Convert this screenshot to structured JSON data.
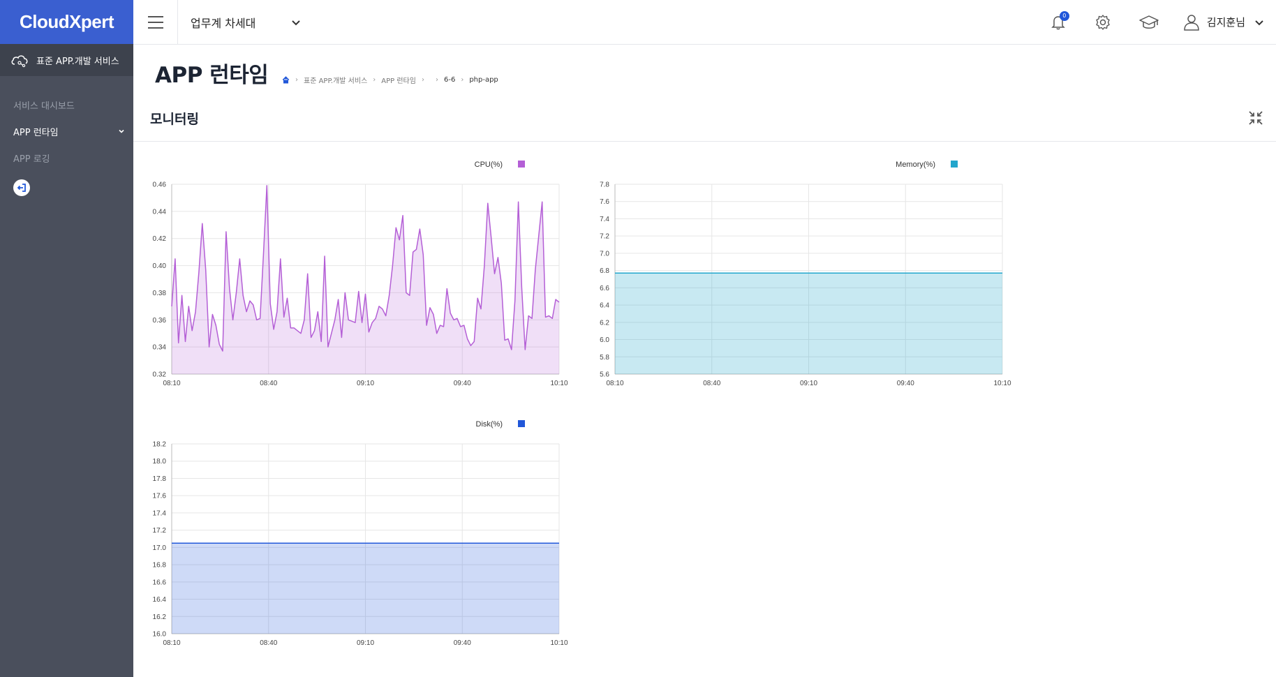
{
  "app": {
    "logo": "CloudXpert"
  },
  "sidebar": {
    "service_label": "표준 APP.개발 서비스",
    "items": [
      {
        "label": "서비스 대시보드",
        "active": false
      },
      {
        "label": "APP 런타임",
        "active": true
      },
      {
        "label": "APP 로깅",
        "active": false
      }
    ]
  },
  "header": {
    "workspace": "업무계 차세대",
    "notification_count": "0",
    "user_name": "김지훈님"
  },
  "page": {
    "title": "APP 런타임",
    "breadcrumb": [
      "표준 APP.개발 서비스",
      "APP 런타임",
      "",
      "6-6",
      "php-app"
    ]
  },
  "section": {
    "title": "모니터링"
  },
  "colors": {
    "accent": "#3a5fd0",
    "cpu": "#b45fd6",
    "memory": "#22a6cc",
    "disk": "#2157d9"
  },
  "chart_data": [
    {
      "type": "area",
      "title": "",
      "legend": "CPU(%)",
      "x_ticks": [
        "08:10",
        "08:40",
        "09:10",
        "09:40",
        "10:10"
      ],
      "ylim": [
        0.32,
        0.46
      ],
      "y_ticks": [
        "0.46",
        "0.44",
        "0.42",
        "0.40",
        "0.38",
        "0.36",
        "0.34",
        "0.32"
      ],
      "grid": true,
      "series": [
        {
          "name": "CPU(%)",
          "values": [
            0.37,
            0.405,
            0.343,
            0.378,
            0.344,
            0.37,
            0.352,
            0.366,
            0.395,
            0.431,
            0.397,
            0.34,
            0.364,
            0.356,
            0.342,
            0.337,
            0.425,
            0.383,
            0.36,
            0.38,
            0.405,
            0.378,
            0.366,
            0.374,
            0.371,
            0.36,
            0.361,
            0.408,
            0.459,
            0.372,
            0.353,
            0.366,
            0.405,
            0.362,
            0.376,
            0.354,
            0.354,
            0.352,
            0.35,
            0.36,
            0.394,
            0.347,
            0.352,
            0.366,
            0.344,
            0.407,
            0.34,
            0.35,
            0.36,
            0.375,
            0.347,
            0.38,
            0.36,
            0.359,
            0.358,
            0.381,
            0.358,
            0.379,
            0.351,
            0.358,
            0.361,
            0.37,
            0.368,
            0.363,
            0.378,
            0.4,
            0.428,
            0.419,
            0.437,
            0.38,
            0.378,
            0.41,
            0.412,
            0.427,
            0.408,
            0.356,
            0.369,
            0.364,
            0.35,
            0.356,
            0.355,
            0.383,
            0.365,
            0.36,
            0.361,
            0.355,
            0.356,
            0.346,
            0.341,
            0.344,
            0.376,
            0.368,
            0.4,
            0.446,
            0.421,
            0.394,
            0.406,
            0.387,
            0.345,
            0.346,
            0.338,
            0.374,
            0.447,
            0.384,
            0.338,
            0.363,
            0.361,
            0.397,
            0.422,
            0.447,
            0.362,
            0.363,
            0.361,
            0.375,
            0.373
          ]
        }
      ]
    },
    {
      "type": "area",
      "title": "",
      "legend": "Memory(%)",
      "x_ticks": [
        "08:10",
        "08:40",
        "09:10",
        "09:40",
        "10:10"
      ],
      "ylim": [
        5.6,
        7.8
      ],
      "y_ticks": [
        "7.8",
        "7.6",
        "7.4",
        "7.2",
        "7.0",
        "6.8",
        "6.6",
        "6.4",
        "6.2",
        "6.0",
        "5.8",
        "5.6"
      ],
      "grid": true,
      "series": [
        {
          "name": "Memory(%)",
          "values": [
            6.77,
            6.77
          ]
        }
      ]
    },
    {
      "type": "area",
      "title": "",
      "legend": "Disk(%)",
      "x_ticks": [
        "08:10",
        "08:40",
        "09:10",
        "09:40",
        "10:10"
      ],
      "ylim": [
        16.0,
        18.2
      ],
      "y_ticks": [
        "18.2",
        "18.0",
        "17.8",
        "17.6",
        "17.4",
        "17.2",
        "17.0",
        "16.8",
        "16.6",
        "16.4",
        "16.2",
        "16.0"
      ],
      "grid": true,
      "series": [
        {
          "name": "Disk(%)",
          "values": [
            17.05,
            17.05
          ]
        }
      ]
    }
  ]
}
